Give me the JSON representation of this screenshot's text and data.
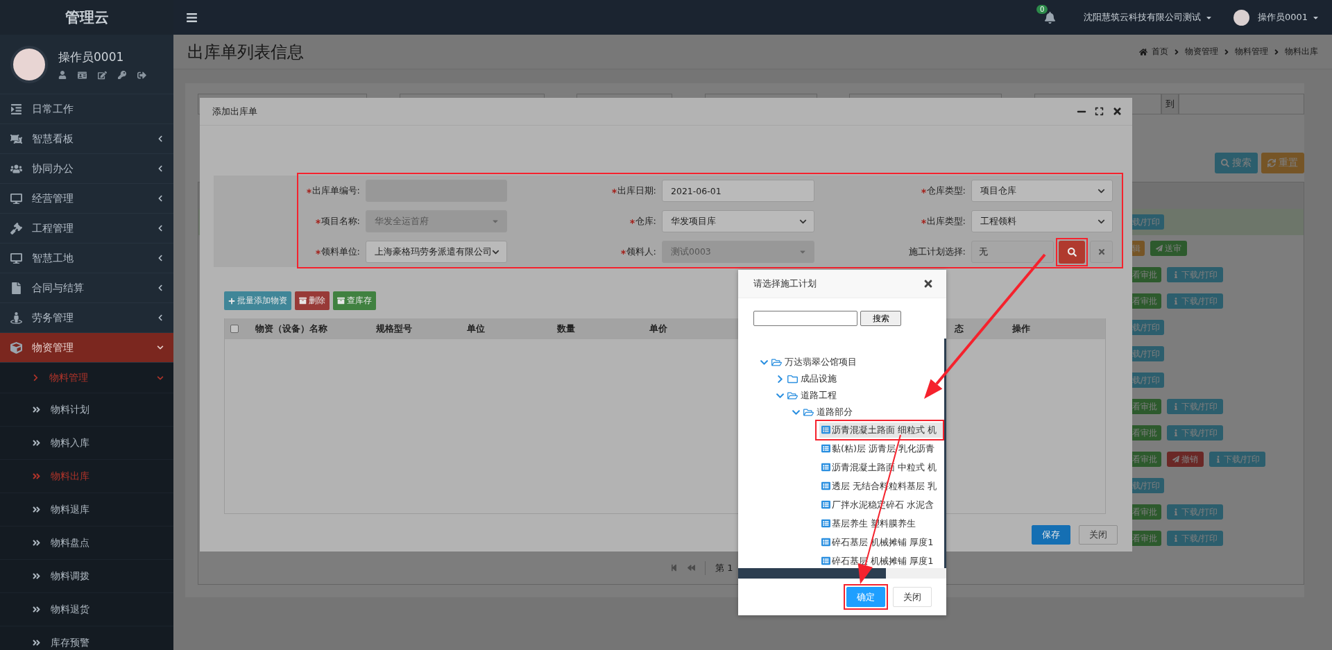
{
  "sidebar": {
    "brand": "管理云",
    "user": {
      "name": "操作员0001"
    },
    "menu": [
      {
        "label": "日常工作",
        "kind": "link",
        "selected": false
      },
      {
        "label": "智慧看板",
        "kind": "group",
        "expanded": false,
        "selected": false
      },
      {
        "label": "协同办公",
        "kind": "group",
        "expanded": false,
        "selected": false
      },
      {
        "label": "经营管理",
        "kind": "group",
        "expanded": false,
        "selected": false
      },
      {
        "label": "工程管理",
        "kind": "group",
        "expanded": false,
        "selected": false
      },
      {
        "label": "智慧工地",
        "kind": "group",
        "expanded": false,
        "selected": false
      },
      {
        "label": "合同与结算",
        "kind": "group",
        "expanded": false,
        "selected": false
      },
      {
        "label": "劳务管理",
        "kind": "group",
        "expanded": false,
        "selected": false
      },
      {
        "label": "物资管理",
        "kind": "group",
        "expanded": true,
        "selected": true,
        "children": [
          {
            "label": "物料管理",
            "expanded": true,
            "selected": true,
            "children": [
              {
                "label": "物料计划",
                "selected": false
              },
              {
                "label": "物料入库",
                "selected": false
              },
              {
                "label": "物料出库",
                "selected": true
              },
              {
                "label": "物料退库",
                "selected": false
              },
              {
                "label": "物料盘点",
                "selected": false
              },
              {
                "label": "物料调拨",
                "selected": false
              },
              {
                "label": "物料退货",
                "selected": false
              },
              {
                "label": "库存预警",
                "selected": false
              }
            ]
          }
        ]
      }
    ]
  },
  "topbar": {
    "notification_count": "0",
    "company": "沈阳慧筑云科技有限公司测试",
    "user": "操作员0001"
  },
  "page": {
    "title": "出库单列表信息",
    "breadcrumb": [
      "首页",
      "物资管理",
      "物料管理",
      "物料出库"
    ]
  },
  "filters": {
    "range_separator": "到",
    "buttons": [
      {
        "label": "搜索",
        "kind": "info"
      },
      {
        "label": "重置",
        "kind": "warning"
      }
    ]
  },
  "list": {
    "rows": [
      {
        "highlighted": true,
        "actions": [
          {
            "label": "载/打印",
            "kind": "info",
            "partial": true
          }
        ]
      },
      {
        "highlighted": false,
        "actions": [
          {
            "label": "辑",
            "kind": "warning",
            "partial": true
          },
          {
            "label": "送审",
            "kind": "success",
            "partial": false
          }
        ]
      },
      {
        "highlighted": false,
        "actions": [
          {
            "label": "看审批",
            "kind": "success",
            "partial": true
          },
          {
            "label": "下载/打印",
            "kind": "info",
            "partial": false
          }
        ]
      },
      {
        "highlighted": false,
        "actions": [
          {
            "label": "看审批",
            "kind": "success",
            "partial": true
          },
          {
            "label": "下载/打印",
            "kind": "info",
            "partial": false
          }
        ]
      },
      {
        "highlighted": false,
        "actions": [
          {
            "label": "载/打印",
            "kind": "info",
            "partial": true
          }
        ]
      },
      {
        "highlighted": false,
        "actions": [
          {
            "label": "载/打印",
            "kind": "info",
            "partial": true
          }
        ]
      },
      {
        "highlighted": false,
        "actions": [
          {
            "label": "载/打印",
            "kind": "info",
            "partial": true
          }
        ]
      },
      {
        "highlighted": false,
        "actions": [
          {
            "label": "看审批",
            "kind": "success",
            "partial": true
          },
          {
            "label": "下载/打印",
            "kind": "info",
            "partial": false
          }
        ]
      },
      {
        "highlighted": false,
        "actions": [
          {
            "label": "看审批",
            "kind": "success",
            "partial": true
          },
          {
            "label": "下载/打印",
            "kind": "info",
            "partial": false
          }
        ]
      },
      {
        "highlighted": false,
        "actions": [
          {
            "label": "看审批",
            "kind": "success",
            "partial": true
          },
          {
            "label": "撤销",
            "kind": "danger",
            "partial": false
          },
          {
            "label": "下载/打印",
            "kind": "info",
            "partial": false
          }
        ]
      },
      {
        "highlighted": false,
        "actions": [
          {
            "label": "载/打印",
            "kind": "info",
            "partial": true
          }
        ]
      },
      {
        "highlighted": false,
        "actions": [
          {
            "label": "看审批",
            "kind": "success",
            "partial": true
          },
          {
            "label": "下载/打印",
            "kind": "info",
            "partial": false
          }
        ]
      },
      {
        "highlighted": false,
        "actions": [
          {
            "label": "看审批",
            "kind": "success",
            "partial": true
          },
          {
            "label": "下载/打印",
            "kind": "info",
            "partial": false
          }
        ]
      }
    ]
  },
  "pagination": {
    "page_label": "第 1"
  },
  "modal": {
    "title": "添加出库单",
    "form": {
      "highlighted": true,
      "fields": [
        {
          "label": "出库单编号:",
          "required": true,
          "kind": "input",
          "disabled": true
        },
        {
          "label": "出库日期:",
          "required": true,
          "kind": "input",
          "disabled": false,
          "value": "2021-06-01"
        },
        {
          "label": "仓库类型:",
          "required": true,
          "kind": "select",
          "disabled": false,
          "value": "项目仓库"
        },
        {
          "label": "项目名称:",
          "required": true,
          "kind": "select",
          "disabled": true,
          "value": "华发全运首府"
        },
        {
          "label": "仓库:",
          "required": true,
          "kind": "select",
          "disabled": false,
          "value": "华发项目库"
        },
        {
          "label": "出库类型:",
          "required": true,
          "kind": "select",
          "disabled": false,
          "value": "工程领料"
        },
        {
          "label": "领料单位:",
          "required": true,
          "kind": "select",
          "disabled": false,
          "value": "上海豪格玛劳务派遣有限公司"
        },
        {
          "label": "领料人:",
          "required": true,
          "kind": "select",
          "disabled": true,
          "value": "测试0003"
        },
        {
          "label": "施工计划选择:",
          "required": false,
          "kind": "picker",
          "disabled": false,
          "value": "无",
          "search_highlighted": true
        }
      ]
    },
    "toolbar": [
      {
        "label": "批量添加物资",
        "kind": "info"
      },
      {
        "label": "删除",
        "kind": "danger"
      },
      {
        "label": "查库存",
        "kind": "success"
      }
    ],
    "table": {
      "select_all": false,
      "columns": [
        "物资（设备）名称",
        "规格型号",
        "单位",
        "数量",
        "单价",
        "态",
        "操作"
      ]
    },
    "buttons": [
      {
        "label": "保存",
        "kind": "primary"
      },
      {
        "label": "关闭",
        "kind": "default"
      }
    ]
  },
  "picker": {
    "title": "请选择施工计划",
    "search_button": "搜索",
    "tree": [
      {
        "label": "万达翡翠公馆项目",
        "kind": "folder",
        "expanded": true,
        "selected": false,
        "children": [
          {
            "label": "成品设施",
            "kind": "folder",
            "expanded": false,
            "selected": false
          },
          {
            "label": "道路工程",
            "kind": "folder",
            "expanded": true,
            "selected": false,
            "children": [
              {
                "label": "道路部分",
                "kind": "folder",
                "expanded": true,
                "selected": false,
                "children": [
                  {
                    "label": "沥青混凝土路面 细粒式 机",
                    "kind": "leaf",
                    "selected": true,
                    "highlighted": true
                  },
                  {
                    "label": "黏(粘)层 沥青层 乳化沥青",
                    "kind": "leaf",
                    "selected": false,
                    "highlighted": false
                  },
                  {
                    "label": "沥青混凝土路面 中粒式 机",
                    "kind": "leaf",
                    "selected": false,
                    "highlighted": false
                  },
                  {
                    "label": "透层 无结合料粒料基层 乳",
                    "kind": "leaf",
                    "selected": false,
                    "highlighted": false
                  },
                  {
                    "label": "厂拌水泥稳定碎石 水泥含",
                    "kind": "leaf",
                    "selected": false,
                    "highlighted": false
                  },
                  {
                    "label": "基层养生 塑料膜养生",
                    "kind": "leaf",
                    "selected": false,
                    "highlighted": false
                  },
                  {
                    "label": "碎石基层 机械摊铺 厚度1",
                    "kind": "leaf",
                    "selected": false,
                    "highlighted": false
                  },
                  {
                    "label": "碎石基层 机械摊铺 厚度1",
                    "kind": "leaf",
                    "selected": false,
                    "highlighted": false
                  }
                ]
              }
            ]
          }
        ]
      }
    ],
    "buttons": [
      {
        "label": "确定",
        "kind": "primary",
        "highlighted": true
      },
      {
        "label": "关闭",
        "kind": "default",
        "highlighted": false
      }
    ]
  }
}
